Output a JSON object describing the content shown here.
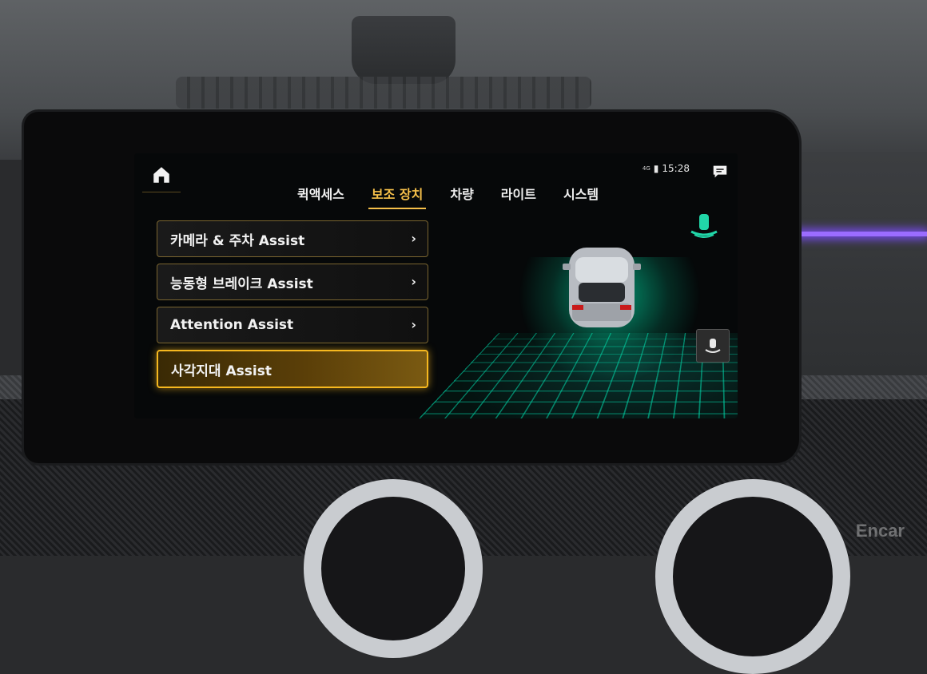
{
  "status": {
    "time": "15:28",
    "network": "4G"
  },
  "tabs": [
    {
      "label": "퀵액세스"
    },
    {
      "label": "보조 장치"
    },
    {
      "label": "차량"
    },
    {
      "label": "라이트"
    },
    {
      "label": "시스템"
    }
  ],
  "active_tab": "보조 장치",
  "menu": [
    {
      "label": "카메라 & 주차 Assist"
    },
    {
      "label": "능동형 브레이크 Assist"
    },
    {
      "label": "Attention Assist"
    },
    {
      "label": "사각지대 Assist"
    }
  ],
  "selected_menu_item": "사각지대 Assist",
  "watermark": "Encar",
  "colors": {
    "accent": "#f6c04a",
    "grid": "#00ffc8",
    "ambient": "#9b6cff"
  },
  "icons": [
    "home-icon",
    "message-icon",
    "chevron-right-icon",
    "driver-assist-icon",
    "car-view-icon"
  ]
}
